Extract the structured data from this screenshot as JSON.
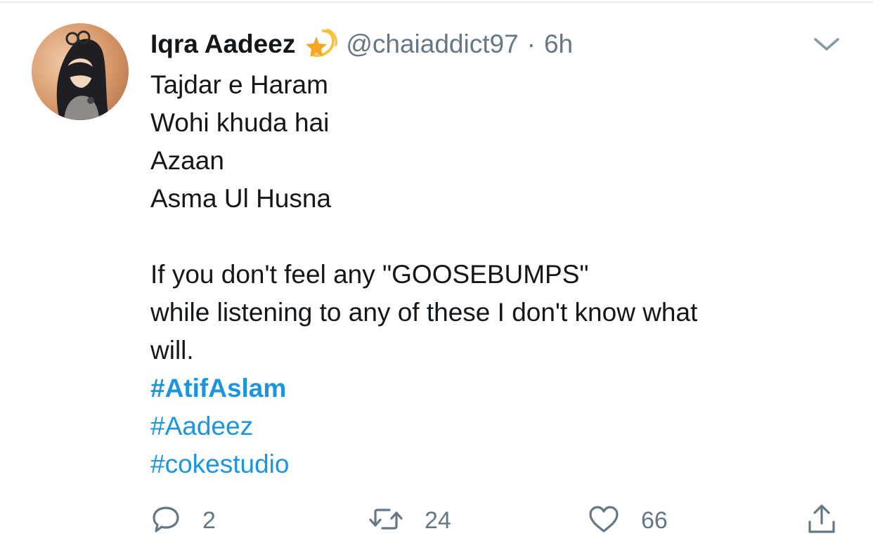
{
  "tweet": {
    "author": {
      "display_name": "Iqra Aadeez",
      "handle": "@chaiaddict97",
      "separator": "·",
      "time": "6h"
    },
    "lines": [
      "Tajdar e Haram",
      "Wohi khuda hai",
      "Azaan",
      "Asma Ul Husna",
      "",
      "If you don't feel any \"GOOSEBUMPS\"",
      "while listening to any of these I don't know what",
      "will."
    ],
    "hashtags": [
      "#AtifAslam",
      "#Aadeez",
      "#cokestudio"
    ],
    "actions": {
      "reply_count": "2",
      "retweet_count": "24",
      "like_count": "66"
    }
  },
  "icons": {
    "badge": "star-badge-icon",
    "menu": "chevron-down-icon",
    "reply": "reply-bubble-icon",
    "retweet": "retweet-icon",
    "like": "heart-icon",
    "share": "share-upload-icon"
  },
  "colors": {
    "text": "#14171a",
    "secondary": "#657786",
    "link": "#1b95e0",
    "divider": "#e6ecf0"
  }
}
